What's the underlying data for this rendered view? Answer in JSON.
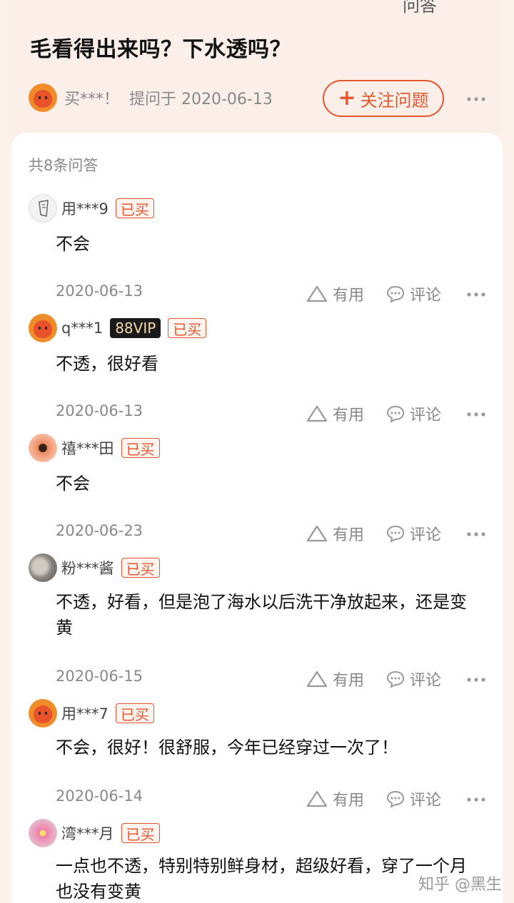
{
  "top_edge_text": "问答",
  "question": {
    "title": "毛看得出来吗？下水透吗？",
    "asker": "买***！",
    "asked_on": "提问于 2020-06-13",
    "follow_label": "关注问题"
  },
  "answers_panel": {
    "count_label": "共8条问答",
    "useful_label": "有用",
    "comment_label": "评论",
    "answers": [
      {
        "user": "用***9",
        "vip": "",
        "bought": "已买",
        "text": "不会",
        "date": "2020-06-13"
      },
      {
        "user": "q***1",
        "vip": "88VIP",
        "bought": "已买",
        "text": "不透，很好看",
        "date": "2020-06-13"
      },
      {
        "user": "禧***田",
        "vip": "",
        "bought": "已买",
        "text": "不会",
        "date": "2020-06-23"
      },
      {
        "user": "粉***酱",
        "vip": "",
        "bought": "已买",
        "text": "不透，好看，但是泡了海水以后洗干净放起来，还是变黄",
        "date": "2020-06-15"
      },
      {
        "user": "用***7",
        "vip": "",
        "bought": "已买",
        "text": "不会，很好！很舒服，今年已经穿过一次了！",
        "date": "2020-06-14"
      },
      {
        "user": "湾***月",
        "vip": "",
        "bought": "已买",
        "text": "一点也不透，特别特别鲜身材，超级好看，穿了一个月也没有变黄",
        "date": ""
      }
    ]
  },
  "watermark": "知乎 @黑生",
  "colors": {
    "accent": "#e4572e",
    "header_bg": "#fcefe9",
    "muted": "#888888"
  }
}
